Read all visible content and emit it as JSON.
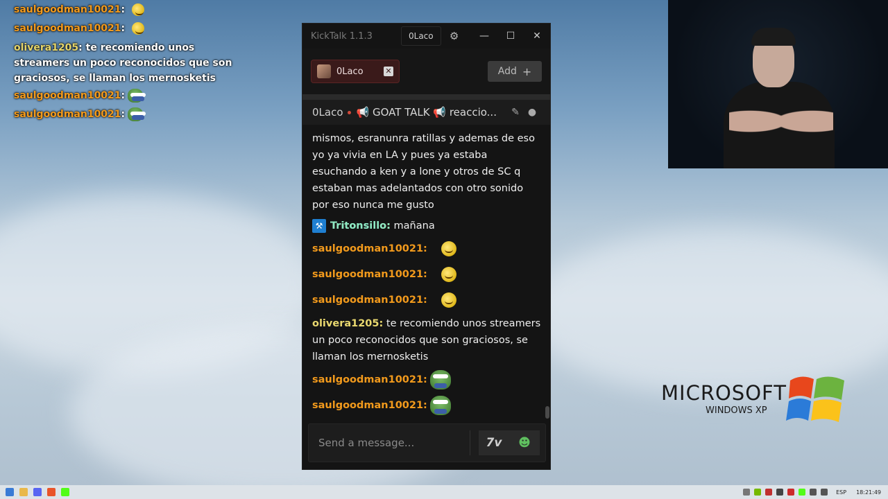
{
  "overlay_chat": [
    {
      "user": "saulgoodman10021",
      "color": "orange",
      "text": "",
      "emote": "yellow-smiley"
    },
    {
      "user": "saulgoodman10021",
      "color": "orange",
      "text": "",
      "emote": "yellow-smiley"
    },
    {
      "user": "olivera1205",
      "color": "yellow",
      "text": "te recomiendo unos streamers un poco reconocidos que son graciosos, se llaman los mernosketis",
      "emote": ""
    },
    {
      "user": "saulgoodman10021",
      "color": "orange",
      "text": "",
      "emote": "pepe"
    },
    {
      "user": "saulgoodman10021",
      "color": "orange",
      "text": "",
      "emote": "pepe"
    }
  ],
  "window": {
    "title": "KickTalk 1.1.3",
    "username": "0Laco",
    "minimize": "—",
    "maximize": "☐",
    "close": "✕"
  },
  "tabs": {
    "items": [
      {
        "label": "0Laco"
      }
    ],
    "add_label": "Add",
    "add_plus": "+"
  },
  "channel_header": {
    "channel": "0Laco",
    "stream_title": "📢 GOAT TALK 📢 reaccio..."
  },
  "messages": {
    "continuation": "mismos, esranunra ratillas y ademas de eso yo ya vivia en LA y pues ya estaba esuchando a ken y a lone y otros de SC q estaban mas adelantados con otro sonido por eso nunca me gusto",
    "items": [
      {
        "user": "Tritonsillo:",
        "text": "mañana",
        "type": "triton"
      },
      {
        "user": "saulgoodman10021:",
        "text": "",
        "type": "yellow-emote"
      },
      {
        "user": "saulgoodman10021:",
        "text": "",
        "type": "yellow-emote"
      },
      {
        "user": "saulgoodman10021:",
        "text": "",
        "type": "yellow-emote"
      },
      {
        "user": "olivera1205:",
        "text": "te recomiendo unos streamers un poco reconocidos que son graciosos, se llaman los mernosketis",
        "type": "text"
      },
      {
        "user": "saulgoodman10021:",
        "text": "",
        "type": "pepe-emote"
      },
      {
        "user": "saulgoodman10021:",
        "text": "",
        "type": "pepe-emote"
      }
    ]
  },
  "input": {
    "placeholder": "Send a message...",
    "sevenTV_label": "7v"
  },
  "xp_logo": {
    "line1": "MICROSOFT",
    "line2": "WINDOWS XP"
  },
  "tray": {
    "language": "ESP",
    "clock": "18:21:49"
  },
  "colors": {
    "username_orange": "#f29a1c",
    "username_yellow": "#e9d86f",
    "tab_bg": "#3a1a1a",
    "window_bg": "#141414"
  }
}
